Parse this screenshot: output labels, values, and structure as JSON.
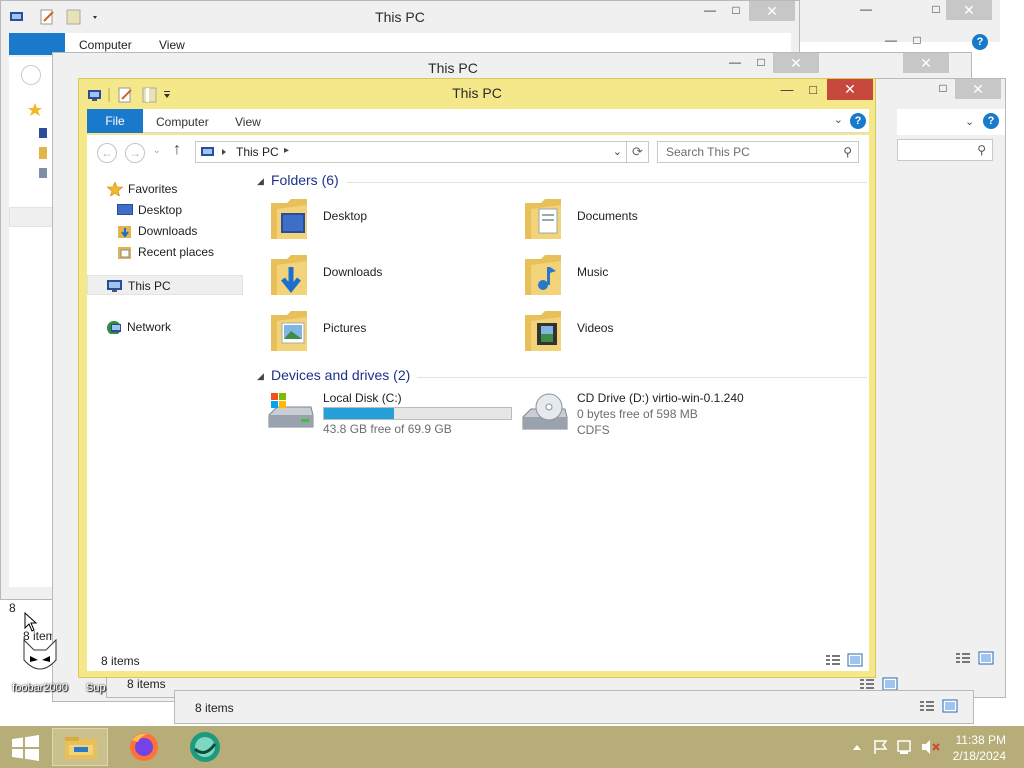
{
  "window": {
    "title": "This PC"
  },
  "ribbon": {
    "file_tab": "File",
    "computer_tab": "Computer",
    "view_tab": "View",
    "help": "?"
  },
  "address": {
    "location": "This PC",
    "search_placeholder": "Search This PC"
  },
  "nav_pane": {
    "favorites": "Favorites",
    "desktop": "Desktop",
    "downloads": "Downloads",
    "recent_places": "Recent places",
    "this_pc": "This PC",
    "network": "Network"
  },
  "folders_group": "Folders (6)",
  "folders": [
    {
      "name": "Desktop",
      "icon": "desktop-folder-icon"
    },
    {
      "name": "Documents",
      "icon": "documents-folder-icon"
    },
    {
      "name": "Downloads",
      "icon": "downloads-folder-icon"
    },
    {
      "name": "Music",
      "icon": "music-folder-icon"
    },
    {
      "name": "Pictures",
      "icon": "pictures-folder-icon"
    },
    {
      "name": "Videos",
      "icon": "videos-folder-icon"
    }
  ],
  "drives_group": "Devices and drives (2)",
  "drives": [
    {
      "name": "Local Disk (C:)",
      "free_text": "43.8 GB free of 69.9 GB",
      "used_fraction": 0.373
    },
    {
      "name": "CD Drive (D:) virtio-win-0.1.240",
      "free_text": "0 bytes free of 598 MB",
      "fs": "CDFS"
    }
  ],
  "status": {
    "items": "8 items"
  },
  "background_windows": {
    "title": "This PC",
    "computer_tab": "Computer",
    "view_tab": "View",
    "items": "8 items",
    "items_truncated": "8 item",
    "item_8": "8"
  },
  "desktop": {
    "foobar_label": "foobar2000",
    "sup_label": "Sup"
  },
  "taskbar": {
    "time": "11:38 PM",
    "date": "2/18/2024"
  },
  "colors": {
    "accent": "#1979ca",
    "active_frame": "#f4e88a",
    "close": "#c7483c",
    "taskbar": "#b7ad79",
    "drive_fill": "#26a0da"
  }
}
